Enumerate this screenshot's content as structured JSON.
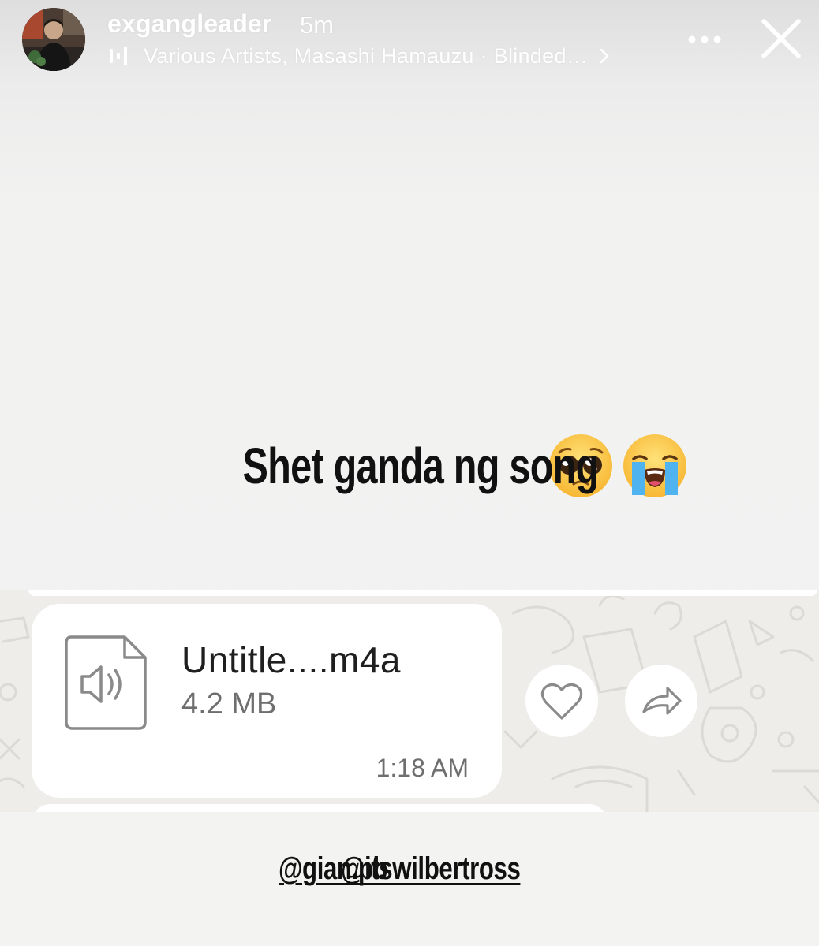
{
  "header": {
    "username": "exgangleader",
    "time_ago": "5m",
    "music_label": "Various Artists, Masashi Hamauzu · Blinded…",
    "music_icon": "music-bars-icon",
    "more_icon": "more-dots-icon",
    "close_icon": "close-icon"
  },
  "caption": {
    "text": "Shet ganda ng song",
    "emojis": [
      "pleading-face-emoji",
      "loudly-crying-face-emoji"
    ]
  },
  "chat": {
    "file_name": "Untitle....m4a",
    "file_size": "4.2 MB",
    "time": "1:18 AM",
    "file_icon": "audio-file-icon",
    "like_icon": "heart-icon",
    "forward_icon": "forward-arrow-icon"
  },
  "mentions": [
    "@gian.pb",
    "@itswilbertross"
  ],
  "colors": {
    "text_dark": "#111111",
    "header_text": "#ffffff",
    "bubble": "#ffffff",
    "chat_background": "#eeedea",
    "secondary_text": "#6e6e6e"
  }
}
